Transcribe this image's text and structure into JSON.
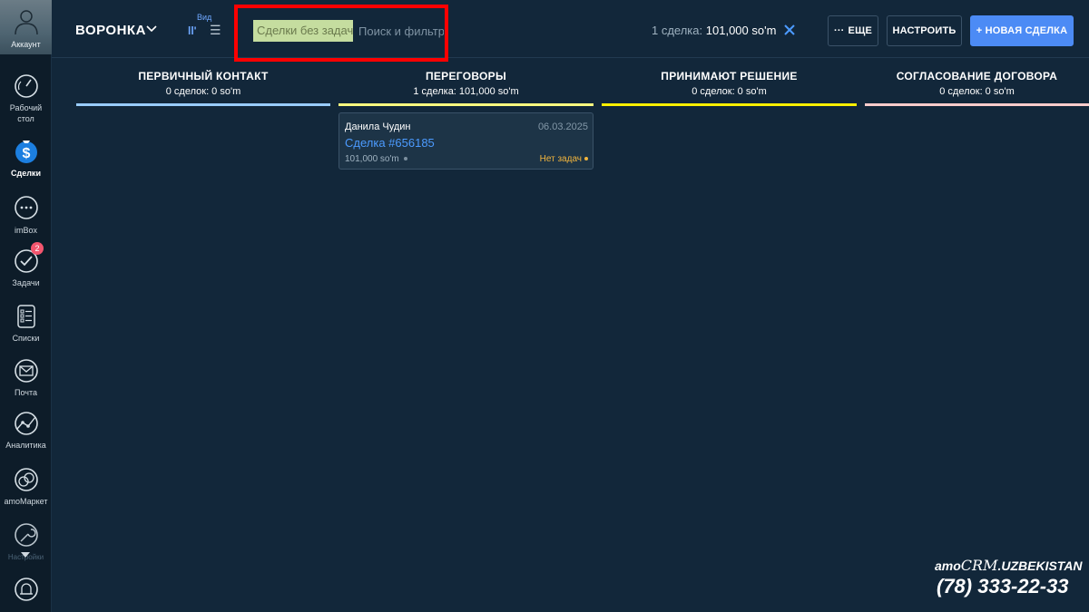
{
  "sidebar": {
    "account_label": "Аккаунт",
    "items": [
      {
        "label": "Рабочий стол",
        "icon": "speedometer-icon"
      },
      {
        "label": "Сделки",
        "icon": "deals-icon",
        "active": true
      },
      {
        "label": "imBox",
        "icon": "chat-icon"
      },
      {
        "label": "Задачи",
        "icon": "check-icon",
        "badge": "2"
      },
      {
        "label": "Списки",
        "icon": "list-icon"
      },
      {
        "label": "Почта",
        "icon": "mail-icon"
      },
      {
        "label": "Аналитика",
        "icon": "analytics-icon"
      },
      {
        "label": "amoМаркет",
        "icon": "market-icon"
      },
      {
        "label": "Настройки",
        "icon": "wrench-icon"
      },
      {
        "label": "",
        "icon": "bell-icon"
      }
    ]
  },
  "header": {
    "title": "ВОРОНКА",
    "view_label": "Вид",
    "filter_chip": "Сделки без задач",
    "search_placeholder": "Поиск и фильтр",
    "summary_count": "1 сделка:",
    "summary_amount": "101,000 so'm",
    "more_label": "ЕЩЕ",
    "settings_label": "НАСТРОИТЬ",
    "new_deal_label": "+ НОВАЯ СДЕЛКА"
  },
  "pipeline": {
    "columns": [
      {
        "name": "ПЕРВИЧНЫЙ КОНТАКТ",
        "meta": "0 сделок: 0 so'm",
        "color": "#99ccfd"
      },
      {
        "name": "ПЕРЕГОВОРЫ",
        "meta": "1 сделка: 101,000 so'm",
        "color": "#fffd7f"
      },
      {
        "name": "ПРИНИМАЮТ РЕШЕНИЕ",
        "meta": "0 сделок: 0 so'm",
        "color": "#fff000"
      },
      {
        "name": "СОГЛАСОВАНИЕ ДОГОВОРА",
        "meta": "0 сделок: 0 so'm",
        "color": "#ffcccc"
      }
    ],
    "deal": {
      "contact": "Данила Чудин",
      "date": "06.03.2025",
      "name": "Сделка #656185",
      "price": "101,000 so'm",
      "task_status": "Нет задач"
    }
  },
  "watermark": {
    "brand_prefix": "amo",
    "brand_crm": "CRM",
    "brand_suffix": ".UZBEKISTAN",
    "phone": "(78) 333-22-33"
  },
  "colors": {
    "background": "#12273a",
    "sidebar": "#0d1c29",
    "accent": "#4c8bf5",
    "highlight": "#ff0000",
    "filter_chip": "#c5dd9f"
  }
}
